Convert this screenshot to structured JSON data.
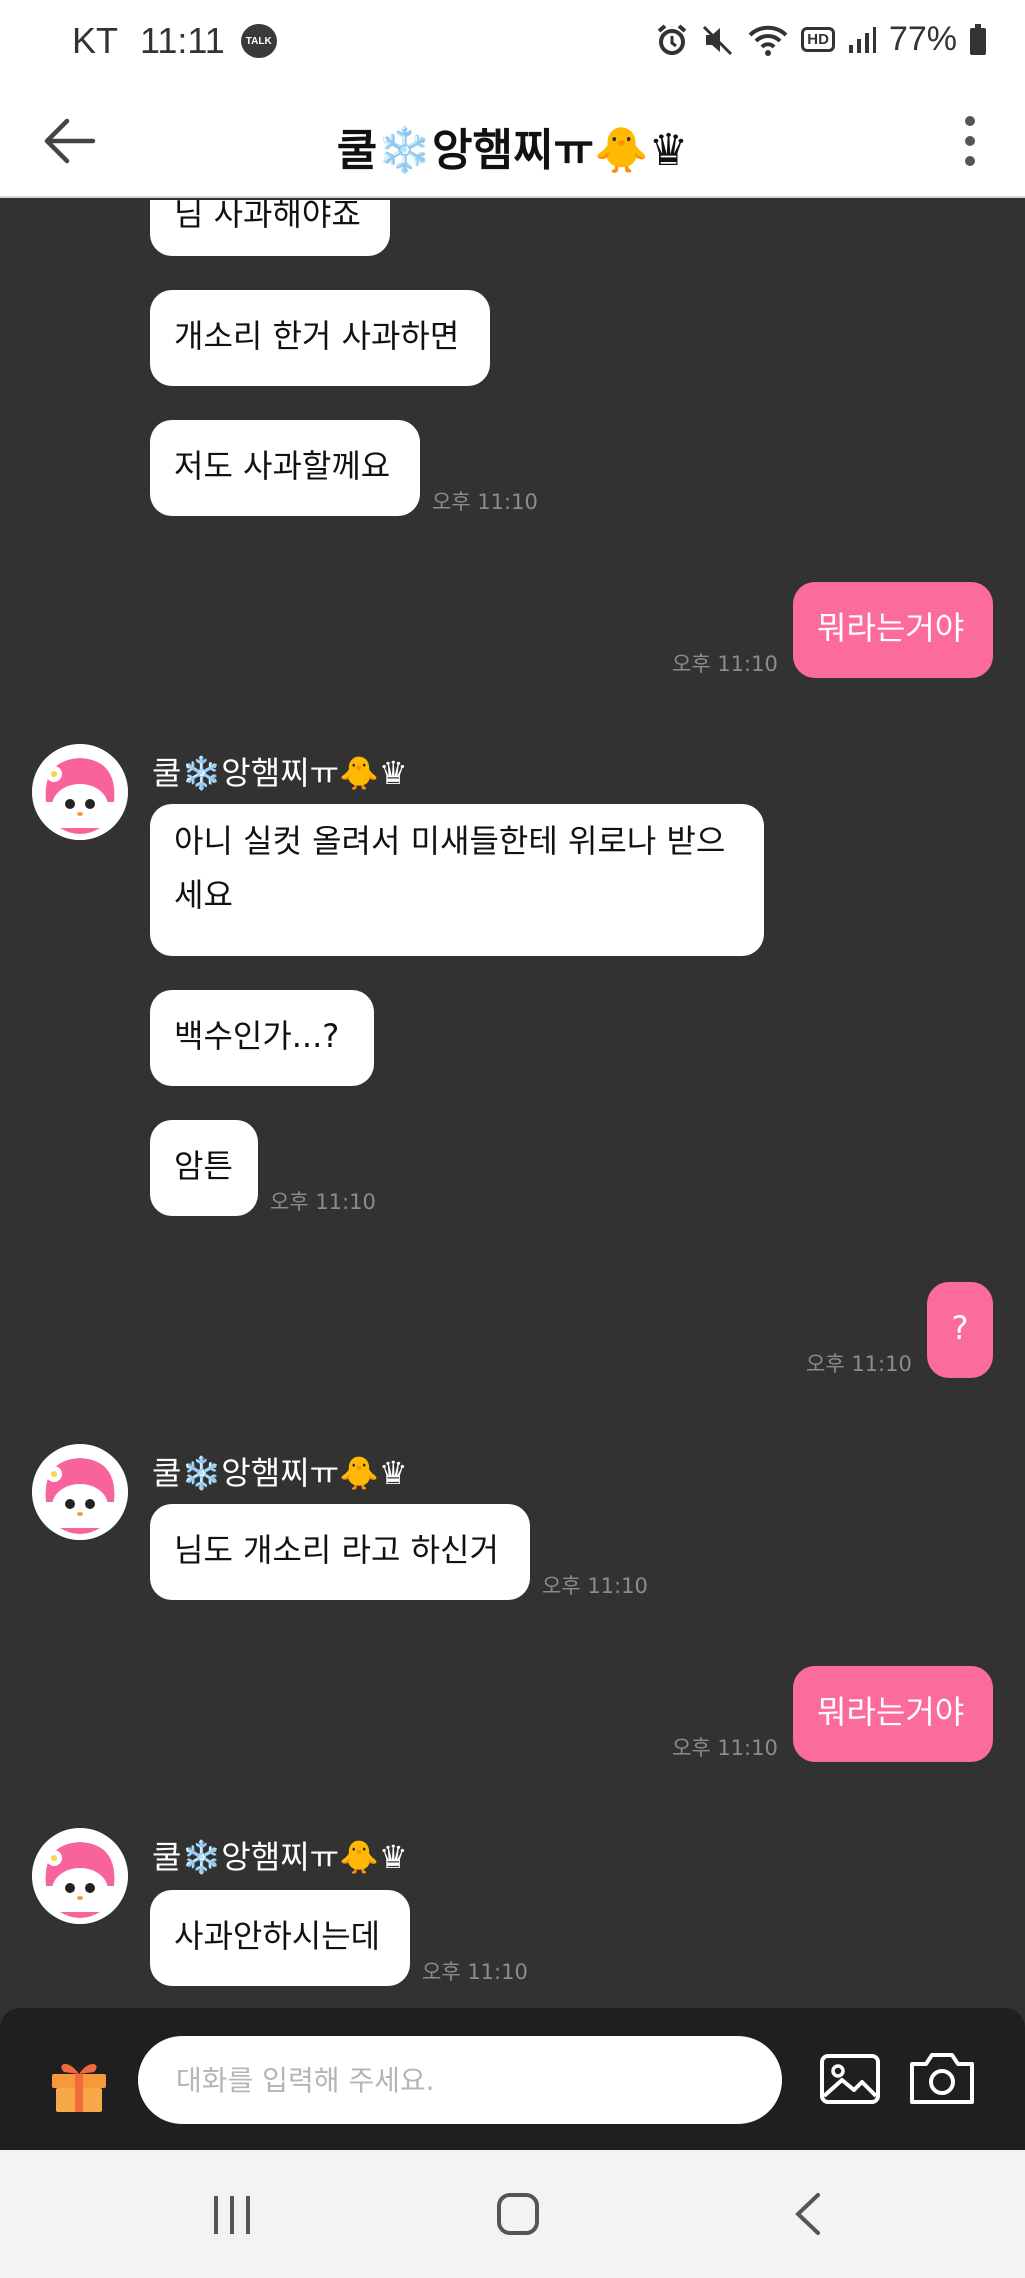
{
  "status_bar": {
    "carrier": "KT",
    "time": "11:11",
    "talk_badge": "TALK",
    "hd": "HD",
    "battery_percent": "77%",
    "icons": [
      "alarm-icon",
      "mute-icon",
      "wifi-icon",
      "signal-icon",
      "battery-icon"
    ]
  },
  "header": {
    "title": "쿨❄️앙햄찌ㅠ🐥♛",
    "back_icon": "arrow-left-icon",
    "more_icon": "more-vertical-icon"
  },
  "messages": [
    {
      "from": "other",
      "text": "님 사과해야죠"
    },
    {
      "from": "other",
      "text": "개소리 한거 사과하면"
    },
    {
      "from": "other",
      "text": "저도 사과할께요",
      "time": "오후 11:10"
    },
    {
      "from": "me",
      "text": "뭐라는거야",
      "time": "오후 11:10"
    },
    {
      "from": "other",
      "sender": "쿨❄️앙햄찌ㅠ🐥♛",
      "text": "아니 실컷 올려서 미새들한테 위로나 받으세요"
    },
    {
      "from": "other",
      "text": "백수인가...?"
    },
    {
      "from": "other",
      "text": "암튼",
      "time": "오후 11:10"
    },
    {
      "from": "me",
      "text": "?",
      "time": "오후 11:10"
    },
    {
      "from": "other",
      "sender": "쿨❄️앙햄찌ㅠ🐥♛",
      "text": "님도 개소리 라고 하신거",
      "time": "오후 11:10"
    },
    {
      "from": "me",
      "text": "뭐라는거야",
      "time": "오후 11:10"
    },
    {
      "from": "other",
      "sender": "쿨❄️앙햄찌ㅠ🐥♛",
      "text": "사과안하시는데",
      "time": "오후 11:10"
    }
  ],
  "input": {
    "placeholder": "대화를 입력해 주세요.",
    "value": ""
  },
  "colors": {
    "background": "#323233",
    "my_bubble": "#fb6b9c",
    "their_bubble": "#ffffff",
    "input_bar": "#1f1f1f"
  }
}
